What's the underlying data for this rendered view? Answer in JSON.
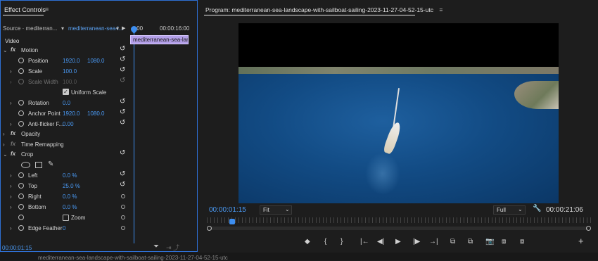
{
  "effect_controls": {
    "tab_title": "Effect Controls",
    "tab_menu_glyph": "≡",
    "source_label": "Source · mediterran...",
    "source_dropdown_glyph": "▾",
    "clip_label": "mediterranean-sea-l...",
    "clip_dropdown_glyph": "▾",
    "play_glyph": "▶",
    "timeline_start": ":00",
    "timeline_end": "00:00:16:00",
    "clip_bar_label": "mediterranean-sea-lan",
    "section_video": "Video",
    "rows": {
      "motion": "Motion",
      "position": "Position",
      "position_x": "1920.0",
      "position_y": "1080.0",
      "scale": "Scale",
      "scale_value": "100.0",
      "scale_width": "Scale Width",
      "scale_width_value": "100.0",
      "uniform_scale": "Uniform Scale",
      "rotation": "Rotation",
      "rotation_value": "0.0",
      "anchor_point": "Anchor Point",
      "anchor_x": "1920.0",
      "anchor_y": "1080.0",
      "anti_flicker": "Anti-flicker F...",
      "anti_flicker_value": "0.00",
      "opacity": "Opacity",
      "time_remapping": "Time Remapping",
      "crop": "Crop",
      "left": "Left",
      "left_value": "0.0 %",
      "top": "Top",
      "top_value": "25.0 %",
      "right": "Right",
      "right_value": "0.0 %",
      "bottom": "Bottom",
      "bottom_value": "0.0 %",
      "zoom": "Zoom",
      "edge_feather": "Edge Feather",
      "edge_feather_value": "0"
    },
    "current_time": "00:00:01:15"
  },
  "program_monitor": {
    "title": "Program: mediterranean-sea-landscape-with-sailboat-sailing-2023-11-27-04-52-15-utc",
    "title_menu_glyph": "≡",
    "current_time": "00:00:01:15",
    "zoom_option": "Fit",
    "resolution_option": "Full",
    "duration": "00:00:21:06",
    "transport_glyphs": [
      "◆",
      "{",
      "}",
      "|←",
      "◀|",
      "▶",
      "|▶",
      "→|",
      "⧉",
      "⧉",
      "📷",
      "⧈",
      "⧈",
      "+"
    ]
  },
  "bottom_strip": {
    "text": "mediterranean-sea-landscape-with-sailboat-sailing-2023-11-27-04-52-15-utc"
  },
  "colors": {
    "accent_blue": "#4a9af5",
    "clip_purple": "#b39fe8",
    "panel_bg": "#1d1d1d"
  }
}
